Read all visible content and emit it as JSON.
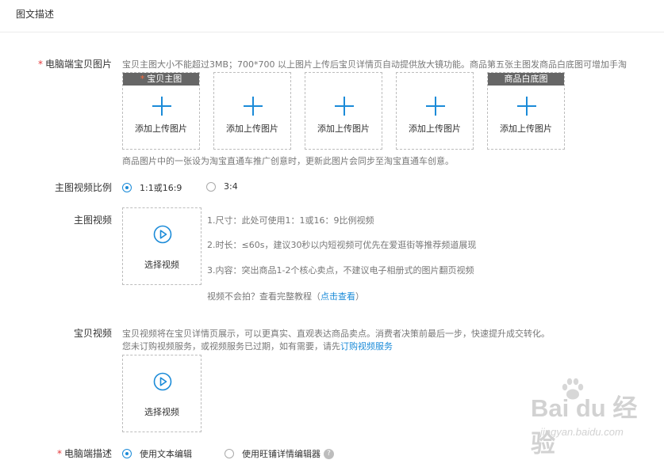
{
  "section": {
    "title": "图文描述"
  },
  "pc_images": {
    "label": "电脑端宝贝图片",
    "required_mark": "*",
    "hint": "宝贝主图大小不能超过3MB；700*700 以上图片上传后宝贝详情页自动提供放大镜功能。商品第五张主图发商品白底图可增加手淘",
    "slots": [
      {
        "header": "宝贝主图",
        "required_mark": "*",
        "label": "添加上传图片"
      },
      {
        "header": "",
        "required_mark": "",
        "label": "添加上传图片"
      },
      {
        "header": "",
        "required_mark": "",
        "label": "添加上传图片"
      },
      {
        "header": "",
        "required_mark": "",
        "label": "添加上传图片"
      },
      {
        "header": "商品白底图",
        "required_mark": "",
        "label": "添加上传图片"
      }
    ],
    "footer_hint": "商品图片中的一张设为淘宝直通车推广创意时，更新此图片会同步至淘宝直通车创意。"
  },
  "video_ratio": {
    "label": "主图视频比例",
    "options": [
      {
        "label": "1:1或16:9",
        "checked": true
      },
      {
        "label": "3:4",
        "checked": false
      }
    ]
  },
  "main_video": {
    "label": "主图视频",
    "select_label": "选择视频",
    "notes": [
      "1.尺寸：此处可使用1：1或16：9比例视频",
      "2.时长：≤60s，建议30秒以内短视频可优先在爱逛街等推荐频道展现",
      "3.内容：突出商品1-2个核心卖点，不建议电子相册式的图片翻页视频"
    ],
    "tutorial_prefix": "视频不会拍？查看完整教程（",
    "tutorial_link": "点击查看",
    "tutorial_suffix": "）"
  },
  "item_video": {
    "label": "宝贝视频",
    "hint1": "宝贝视频将在宝贝详情页展示，可以更真实、直观表达商品卖点。消费者决策前最后一步，快速提升成交转化。",
    "hint2_prefix": "您未订购视频服务，或视频服务已过期，如有需要，请先",
    "hint2_link": "订购视频服务",
    "select_label": "选择视频"
  },
  "pc_desc": {
    "label": "电脑端描述",
    "required_mark": "*",
    "options": [
      {
        "label": "使用文本编辑",
        "checked": true
      },
      {
        "label": "使用旺铺详情编辑器",
        "checked": false
      }
    ],
    "help": "?"
  },
  "watermark": {
    "logo": "Bai du 经验",
    "url": "jingyan.baidu.com"
  },
  "colors": {
    "accent": "#1b8bd8",
    "required": "#e4393c",
    "slot_header": "#666666"
  },
  "icons": {
    "upload": "plus-icon",
    "video": "play-circle-icon",
    "help": "question-icon"
  }
}
